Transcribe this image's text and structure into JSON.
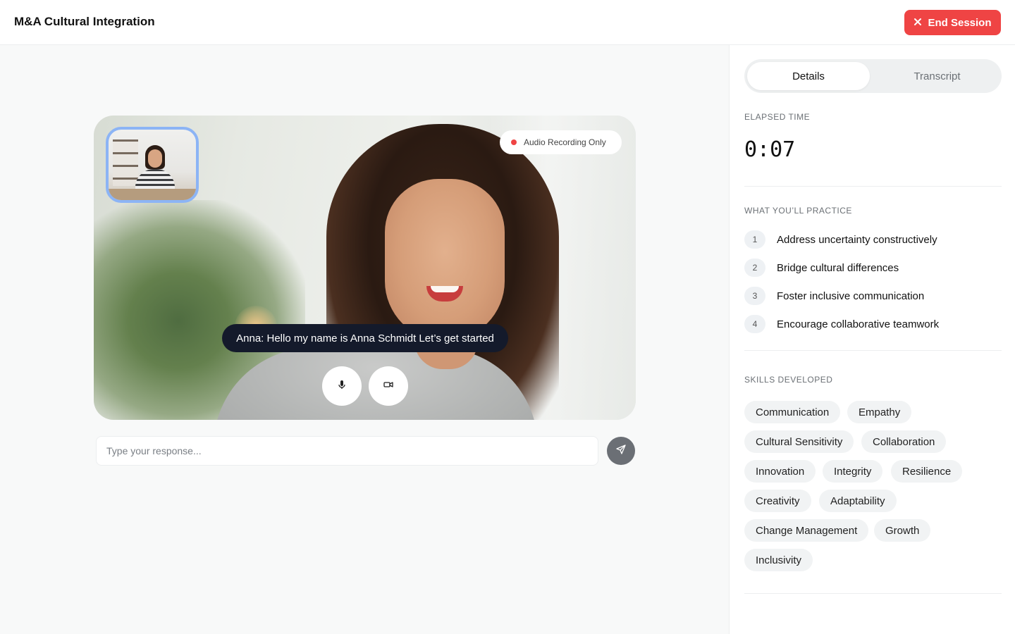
{
  "header": {
    "title": "M&A Cultural Integration",
    "end_session_label": "End Session"
  },
  "video": {
    "recording_badge": "Audio Recording Only",
    "caption": "Anna: Hello my name is Anna Schmidt Let’s get started"
  },
  "response": {
    "placeholder": "Type your response..."
  },
  "tabs": {
    "details": "Details",
    "transcript": "Transcript",
    "active": "Details"
  },
  "details": {
    "elapsed_label": "ELAPSED TIME",
    "elapsed_value": "0:07",
    "practice_label": "WHAT YOU’LL PRACTICE",
    "practice_items": [
      {
        "num": "1",
        "text": "Address uncertainty constructively"
      },
      {
        "num": "2",
        "text": "Bridge cultural differences"
      },
      {
        "num": "3",
        "text": "Foster inclusive communication"
      },
      {
        "num": "4",
        "text": "Encourage collaborative teamwork"
      }
    ],
    "skills_label": "SKILLS DEVELOPED",
    "skills": [
      "Communication",
      "Empathy",
      "Cultural Sensitivity",
      "Collaboration",
      "Innovation",
      "Integrity",
      "Resilience",
      "Creativity",
      "Adaptability",
      "Change Management",
      "Growth",
      "Inclusivity"
    ]
  },
  "icons": {
    "end_session": "close-icon",
    "mic": "microphone-icon",
    "camera": "video-camera-icon",
    "send": "send-icon"
  },
  "colors": {
    "danger": "#ef4444",
    "caption_bg": "#141a2b",
    "pip_border": "#8cb4f5",
    "send_button": "#6b6f75"
  }
}
